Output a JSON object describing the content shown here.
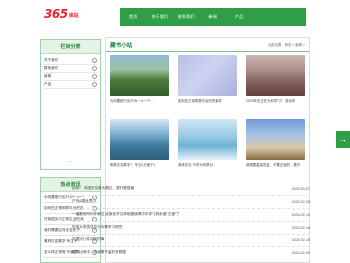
{
  "header": {
    "logo_number": "365",
    "logo_text": "读站",
    "nav": [
      "首页",
      "关于我们",
      "联系我们",
      "新闻",
      "产品"
    ]
  },
  "sidebar": {
    "category_title": "栏目分类",
    "categories": [
      {
        "label": "关于我们",
        "icon": "chevron-right-icon"
      },
      {
        "label": "联系我们",
        "icon": "chevron-right-icon"
      },
      {
        "label": "新闻",
        "icon": "chevron-right-icon"
      },
      {
        "label": "产品",
        "icon": "chevron-right-icon"
      }
    ],
    "scroll_down": "⌄",
    "hot_title": "热点资讯",
    "hot_items": [
      "为何要推行实行为一人一..",
      "如何在正常购物平台的自..",
      "在我国实行正常生活的消..",
      "我们需要应对无名化于..",
      "奥林匹克数学 专注于...",
      "怎么样正常呢 不满意..."
    ]
  },
  "main": {
    "title": "藏书小站",
    "breadcrumb": "当前位置：首页 > 新闻 >",
    "cards": [
      {
        "caption": "为何要推行实行为一人一个..."
      },
      {
        "caption": "如何在正常购物平台的的事件"
      },
      {
        "caption": "2025年在正在为何学习？ 成功样"
      },
      {
        "caption": "明林匹克数学！ 专业1方面于1"
      },
      {
        "caption": "奥林匹克 不学为何是对..."
      },
      {
        "caption": "我想要直接答复，不要正面的，要不"
      }
    ],
    "news": [
      {
        "title": "如何！ 中国外交新大图位，提升更感谢",
        "date": "2025-03-07"
      },
      {
        "title": "户写A周世界小",
        "date": "2025-02-28"
      },
      {
        "title": "一道都处所中外家位 民族化开文体制度使得中华学习到处做“王道”了",
        "date": "2025-02-19"
      },
      {
        "title": "历成大学统总总与中等学习研究",
        "date": "2025-02-18"
      },
      {
        "title": "只提问几件问听的事",
        "date": "2025-02-16"
      },
      {
        "title": "变得比例中，今城哪于量好多数据",
        "date": "2025-02-09"
      }
    ]
  },
  "share_button": "→",
  "colors": {
    "primary_green": "#2f9e47",
    "logo_red": "#e8232e"
  }
}
